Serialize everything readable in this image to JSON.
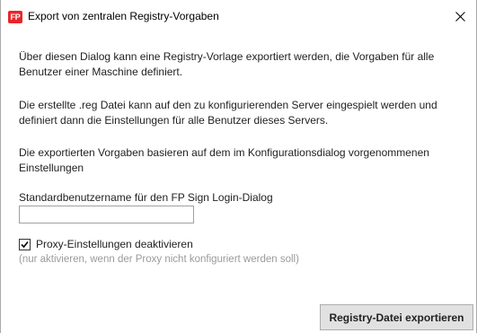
{
  "window": {
    "title": "Export von zentralen Registry-Vorgaben",
    "app_icon_text": "FP",
    "icon": "fp-app-icon",
    "close_icon": "close-icon"
  },
  "content": {
    "paragraph_1": "Über diesen Dialog kann eine Registry-Vorlage exportiert werden, die Vorgaben für alle Benutzer einer Maschine definiert.",
    "paragraph_2": "Die erstellte .reg Datei kann auf den zu konfigurierenden Server eingespielt werden und definiert dann die Einstellungen für alle Benutzer dieses Servers.",
    "paragraph_3": "Die exportierten Vorgaben basieren auf dem im Konfigurationsdialog vorgenommenen Einstellungen"
  },
  "username_field": {
    "label": "Standardbenutzername für den FP Sign Login-Dialog",
    "value": "",
    "placeholder": ""
  },
  "proxy": {
    "label": "Proxy-Einstellungen deaktivieren",
    "checked": true,
    "hint": "(nur aktivieren, wenn der Proxy nicht konfiguriert werden soll)"
  },
  "actions": {
    "export_label": "Registry-Datei exportieren"
  },
  "colors": {
    "icon_red": "#e8262a",
    "button_bg": "#e1e1e1",
    "hint_gray": "#9a9a9a"
  }
}
